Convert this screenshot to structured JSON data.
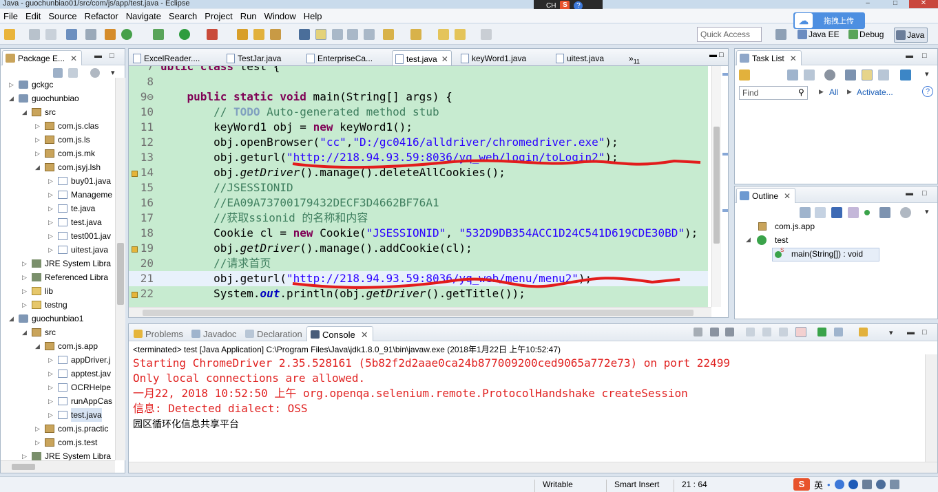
{
  "window": {
    "title": "Java - guochunbiao01/src/com/js/app/test.java - Eclipse",
    "ime_indicator": "CH"
  },
  "menu": [
    "File",
    "Edit",
    "Source",
    "Refactor",
    "Navigate",
    "Search",
    "Project",
    "Run",
    "Window",
    "Help"
  ],
  "toolbar": {
    "quick_access_placeholder": "Quick Access",
    "perspectives": [
      "Java EE",
      "Debug",
      "Java"
    ],
    "upload_label": "拖拽上传"
  },
  "package_explorer": {
    "title": "Package E...",
    "tree": [
      {
        "label": "gckgc",
        "depth": 0,
        "kind": "proj",
        "expanded": false
      },
      {
        "label": "guochunbiao",
        "depth": 0,
        "kind": "proj",
        "expanded": true
      },
      {
        "label": "src",
        "depth": 1,
        "kind": "src",
        "expanded": true
      },
      {
        "label": "com.js.clas",
        "depth": 2,
        "kind": "pkg",
        "expanded": false
      },
      {
        "label": "com.js.ls",
        "depth": 2,
        "kind": "pkg",
        "expanded": false
      },
      {
        "label": "com.js.mk",
        "depth": 2,
        "kind": "pkg",
        "expanded": false
      },
      {
        "label": "com.jsyj.lsh",
        "depth": 2,
        "kind": "pkg",
        "expanded": true
      },
      {
        "label": "buy01.java",
        "depth": 3,
        "kind": "java",
        "expanded": false
      },
      {
        "label": "Manageme",
        "depth": 3,
        "kind": "java",
        "expanded": false
      },
      {
        "label": "te.java",
        "depth": 3,
        "kind": "java",
        "expanded": false
      },
      {
        "label": "test.java",
        "depth": 3,
        "kind": "java",
        "expanded": false
      },
      {
        "label": "test001.jav",
        "depth": 3,
        "kind": "java",
        "expanded": false
      },
      {
        "label": "uitest.java",
        "depth": 3,
        "kind": "java",
        "expanded": false
      },
      {
        "label": "JRE System Libra",
        "depth": 1,
        "kind": "jre",
        "expanded": false
      },
      {
        "label": "Referenced Libra",
        "depth": 1,
        "kind": "jre",
        "expanded": false
      },
      {
        "label": "lib",
        "depth": 1,
        "kind": "lib",
        "expanded": false
      },
      {
        "label": "testng",
        "depth": 1,
        "kind": "lib",
        "expanded": false
      },
      {
        "label": "guochunbiao1",
        "depth": 0,
        "kind": "proj",
        "expanded": true
      },
      {
        "label": "src",
        "depth": 1,
        "kind": "src",
        "expanded": true
      },
      {
        "label": "com.js.app",
        "depth": 2,
        "kind": "pkg",
        "expanded": true
      },
      {
        "label": "appDriver.j",
        "depth": 3,
        "kind": "java",
        "expanded": false
      },
      {
        "label": "apptest.jav",
        "depth": 3,
        "kind": "java",
        "expanded": false
      },
      {
        "label": "OCRHelpe",
        "depth": 3,
        "kind": "java",
        "expanded": false
      },
      {
        "label": "runAppCas",
        "depth": 3,
        "kind": "java",
        "expanded": false
      },
      {
        "label": "test.java",
        "depth": 3,
        "kind": "java",
        "expanded": false,
        "selected": true
      },
      {
        "label": "com.js.practic",
        "depth": 2,
        "kind": "pkg",
        "expanded": false
      },
      {
        "label": "com.js.test",
        "depth": 2,
        "kind": "pkg",
        "expanded": false
      },
      {
        "label": "JRE System Libra",
        "depth": 1,
        "kind": "jre",
        "expanded": false
      }
    ]
  },
  "editor": {
    "tabs": [
      "ExcelReader....",
      "TestJar.java",
      "EnterpriseCa...",
      "test.java",
      "keyWord1.java",
      "uitest.java"
    ],
    "overflow_label": "»",
    "overflow_count": "11",
    "active_tab": "test.java",
    "lines": [
      {
        "n": "7",
        "html": "<span class=\"kw\">ublic class</span> test {"
      },
      {
        "n": "8",
        "html": ""
      },
      {
        "n": "9⊖",
        "html": "    <span class=\"kw\">public static void</span> main(String[] args) {"
      },
      {
        "n": "10",
        "html": "        <span class=\"cmt\">// </span><span class=\"todo\">TODO</span><span class=\"cmt\"> Auto-generated method stub</span>"
      },
      {
        "n": "11",
        "html": "        keyWord1 obj = <span class=\"kw\">new</span> keyWord1();"
      },
      {
        "n": "12",
        "html": "        obj.openBrowser(<span class=\"str\">\"cc\"</span>,<span class=\"str\">\"D:/gc0416/alldriver/chromedriver.exe\"</span>);"
      },
      {
        "n": "13",
        "html": "        obj.geturl(<span class=\"str\">\"http://218.94.93.59:8036/yq_web/login/toLogin2\"</span>);"
      },
      {
        "n": "14",
        "html": "        obj.<span class=\"ita\">getDriver</span>().manage().deleteAllCookies();"
      },
      {
        "n": "15",
        "html": "        <span class=\"cmt\">//JSESSIONID</span>"
      },
      {
        "n": "16",
        "html": "        <span class=\"cmt\">//EA09A73700179432DECF3D4662BF76A1</span>"
      },
      {
        "n": "17",
        "html": "        <span class=\"cmt\">//获取ssionid 的名称和内容</span>"
      },
      {
        "n": "18",
        "html": "        Cookie cl = <span class=\"kw\">new</span> Cookie(<span class=\"str\">\"JSESSIONID\"</span>, <span class=\"str\">\"532D9DB354ACC1D24C541D619CDE30BD\"</span>);"
      },
      {
        "n": "19",
        "html": "        obj.<span class=\"ita\">getDriver</span>().manage().addCookie(cl);"
      },
      {
        "n": "20",
        "html": "        <span class=\"cmt\">//请求首页</span>"
      },
      {
        "n": "21",
        "html": "        obj.geturl(<span class=\"str\">\"http://218.94.93.59:8036/yq_web/menu/menu2\"</span>);"
      },
      {
        "n": "22",
        "html": "        System.<span class=\"fld\">out</span>.println(obj.<span class=\"ita\">getDriver</span>().getTitle());"
      }
    ]
  },
  "task_list": {
    "title": "Task List",
    "find_placeholder": "Find",
    "all_label": "All",
    "activate_label": "Activate..."
  },
  "outline": {
    "title": "Outline",
    "items": [
      "com.js.app",
      "test",
      "main(String[]) : void"
    ]
  },
  "console": {
    "tabs": [
      "Problems",
      "Javadoc",
      "Declaration",
      "Console"
    ],
    "active_tab": "Console",
    "terminated": "<terminated> test [Java Application] C:\\Program Files\\Java\\jdk1.8.0_91\\bin\\javaw.exe (2018年1月22日 上午10:52:47)",
    "lines": [
      {
        "text": "Starting ChromeDriver 2.35.528161 (5b82f2d2aae0ca24b877009200ced9065a772e73) on port 22499",
        "color": "#e0201f"
      },
      {
        "text": "Only local connections are allowed.",
        "color": "#e0201f"
      },
      {
        "text": "一月22, 2018 10:52:50 上午 org.openqa.selenium.remote.ProtocolHandshake createSession",
        "color": "#e0201f"
      },
      {
        "text": "信息: Detected dialect: OSS",
        "color": "#e0201f"
      },
      {
        "text": "园区循环化信息共享平台",
        "color": "#000000"
      }
    ]
  },
  "status": {
    "writable": "Writable",
    "insert_mode": "Smart Insert",
    "position": "21 : 64",
    "ime_lang": "英"
  }
}
